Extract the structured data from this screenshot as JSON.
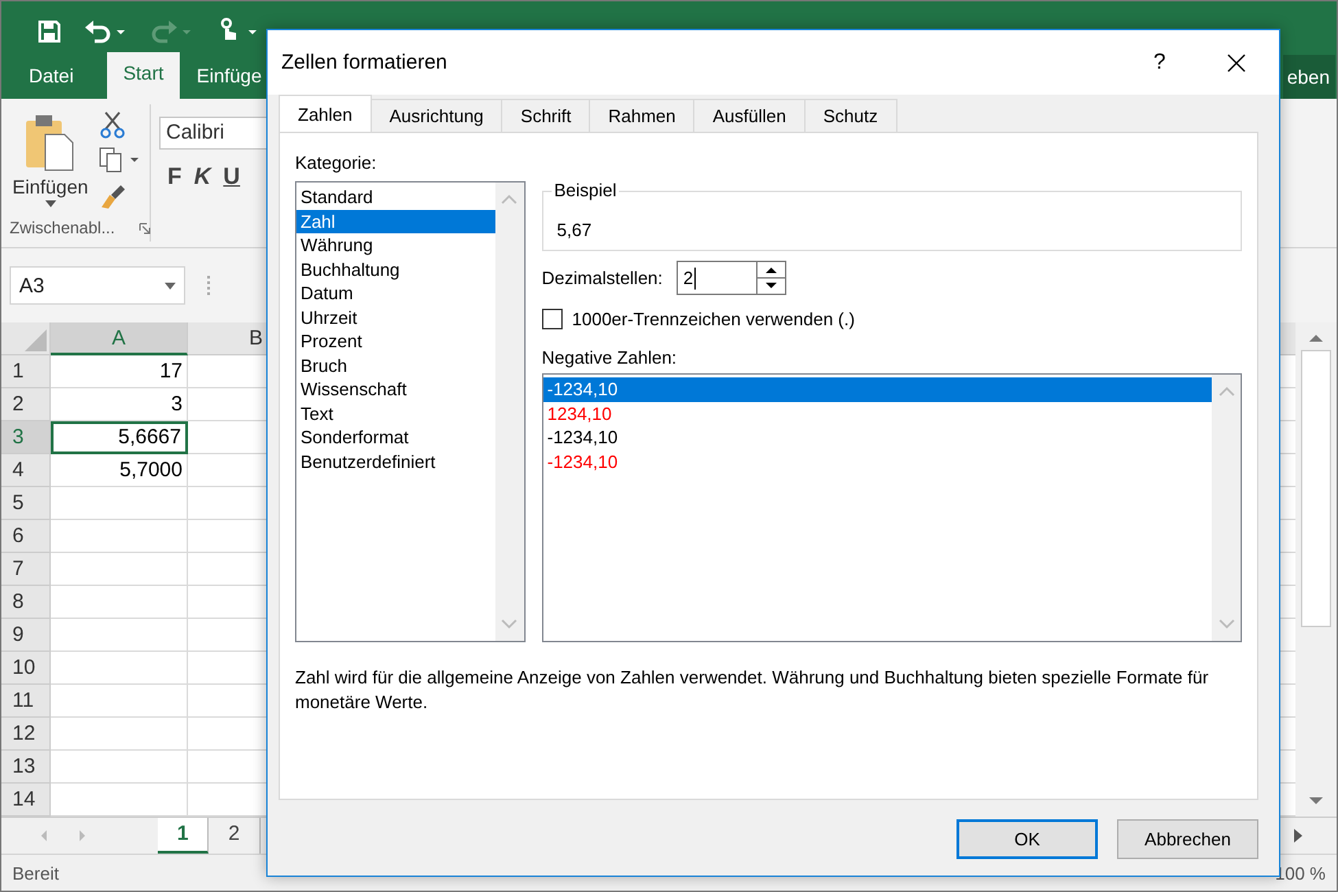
{
  "excel": {
    "ribbon_tabs": [
      {
        "label": "Datei",
        "selected": false
      },
      {
        "label": "Start",
        "selected": true
      },
      {
        "label": "Einfüge",
        "selected": false
      }
    ],
    "share_button": "eben",
    "clipboard": {
      "paste_label": "Einfügen",
      "group_label": "Zwischenabl..."
    },
    "font": {
      "name": "Calibri",
      "buttons": [
        "F",
        "K",
        "U"
      ]
    },
    "name_box": "A3",
    "columns": [
      {
        "label": "A",
        "selected": true
      },
      {
        "label": "B",
        "selected": false
      }
    ],
    "rows": [
      {
        "number": "1",
        "cell": "17",
        "selected": false
      },
      {
        "number": "2",
        "cell": "3",
        "selected": false
      },
      {
        "number": "3",
        "cell": "5,6667",
        "selected": true
      },
      {
        "number": "4",
        "cell": "5,7000",
        "selected": false
      },
      {
        "number": "5",
        "selected": false
      },
      {
        "number": "6",
        "selected": false
      },
      {
        "number": "7",
        "selected": false
      },
      {
        "number": "8",
        "selected": false
      },
      {
        "number": "9",
        "selected": false
      },
      {
        "number": "10",
        "selected": false
      },
      {
        "number": "11",
        "selected": false
      },
      {
        "number": "12",
        "selected": false
      },
      {
        "number": "13",
        "selected": false
      },
      {
        "number": "14",
        "selected": false
      }
    ],
    "sheet_tabs": [
      {
        "label": "1",
        "selected": true
      },
      {
        "label": "2",
        "selected": false
      }
    ],
    "status": "Bereit",
    "zoom": "100 %"
  },
  "dialog": {
    "title": "Zellen formatieren",
    "help": "?",
    "tabs": [
      {
        "label": "Zahlen",
        "selected": true
      },
      {
        "label": "Ausrichtung",
        "selected": false
      },
      {
        "label": "Schrift",
        "selected": false
      },
      {
        "label": "Rahmen",
        "selected": false
      },
      {
        "label": "Ausfüllen",
        "selected": false
      },
      {
        "label": "Schutz",
        "selected": false
      }
    ],
    "category_label": "Kategorie:",
    "categories": [
      {
        "label": "Standard",
        "selected": false
      },
      {
        "label": "Zahl",
        "selected": true
      },
      {
        "label": "Währung",
        "selected": false
      },
      {
        "label": "Buchhaltung",
        "selected": false
      },
      {
        "label": "Datum",
        "selected": false
      },
      {
        "label": "Uhrzeit",
        "selected": false
      },
      {
        "label": "Prozent",
        "selected": false
      },
      {
        "label": "Bruch",
        "selected": false
      },
      {
        "label": "Wissenschaft",
        "selected": false
      },
      {
        "label": "Text",
        "selected": false
      },
      {
        "label": "Sonderformat",
        "selected": false
      },
      {
        "label": "Benutzerdefiniert",
        "selected": false
      }
    ],
    "sample": {
      "label": "Beispiel",
      "value": "5,67"
    },
    "decimals": {
      "label": "Dezimalstellen:",
      "value": "2"
    },
    "thousands": {
      "label": "1000er-Trennzeichen verwenden (.)",
      "checked": false
    },
    "negative": {
      "label": "Negative Zahlen:",
      "options": [
        {
          "text": "-1234,10",
          "selected": true
        },
        {
          "text": "1234,10",
          "color": "#ff0000",
          "selected": false
        },
        {
          "text": "-1234,10",
          "color": "#000000",
          "selected": false
        },
        {
          "text": "-1234,10",
          "color": "#ff0000",
          "selected": false
        }
      ]
    },
    "description": "Zahl wird für die allgemeine Anzeige von Zahlen verwendet. Währung und Buchhaltung bieten spezielle Formate für monetäre Werte.",
    "buttons": [
      {
        "label": "OK",
        "default": true
      },
      {
        "label": "Abbrechen",
        "default": false
      }
    ]
  }
}
